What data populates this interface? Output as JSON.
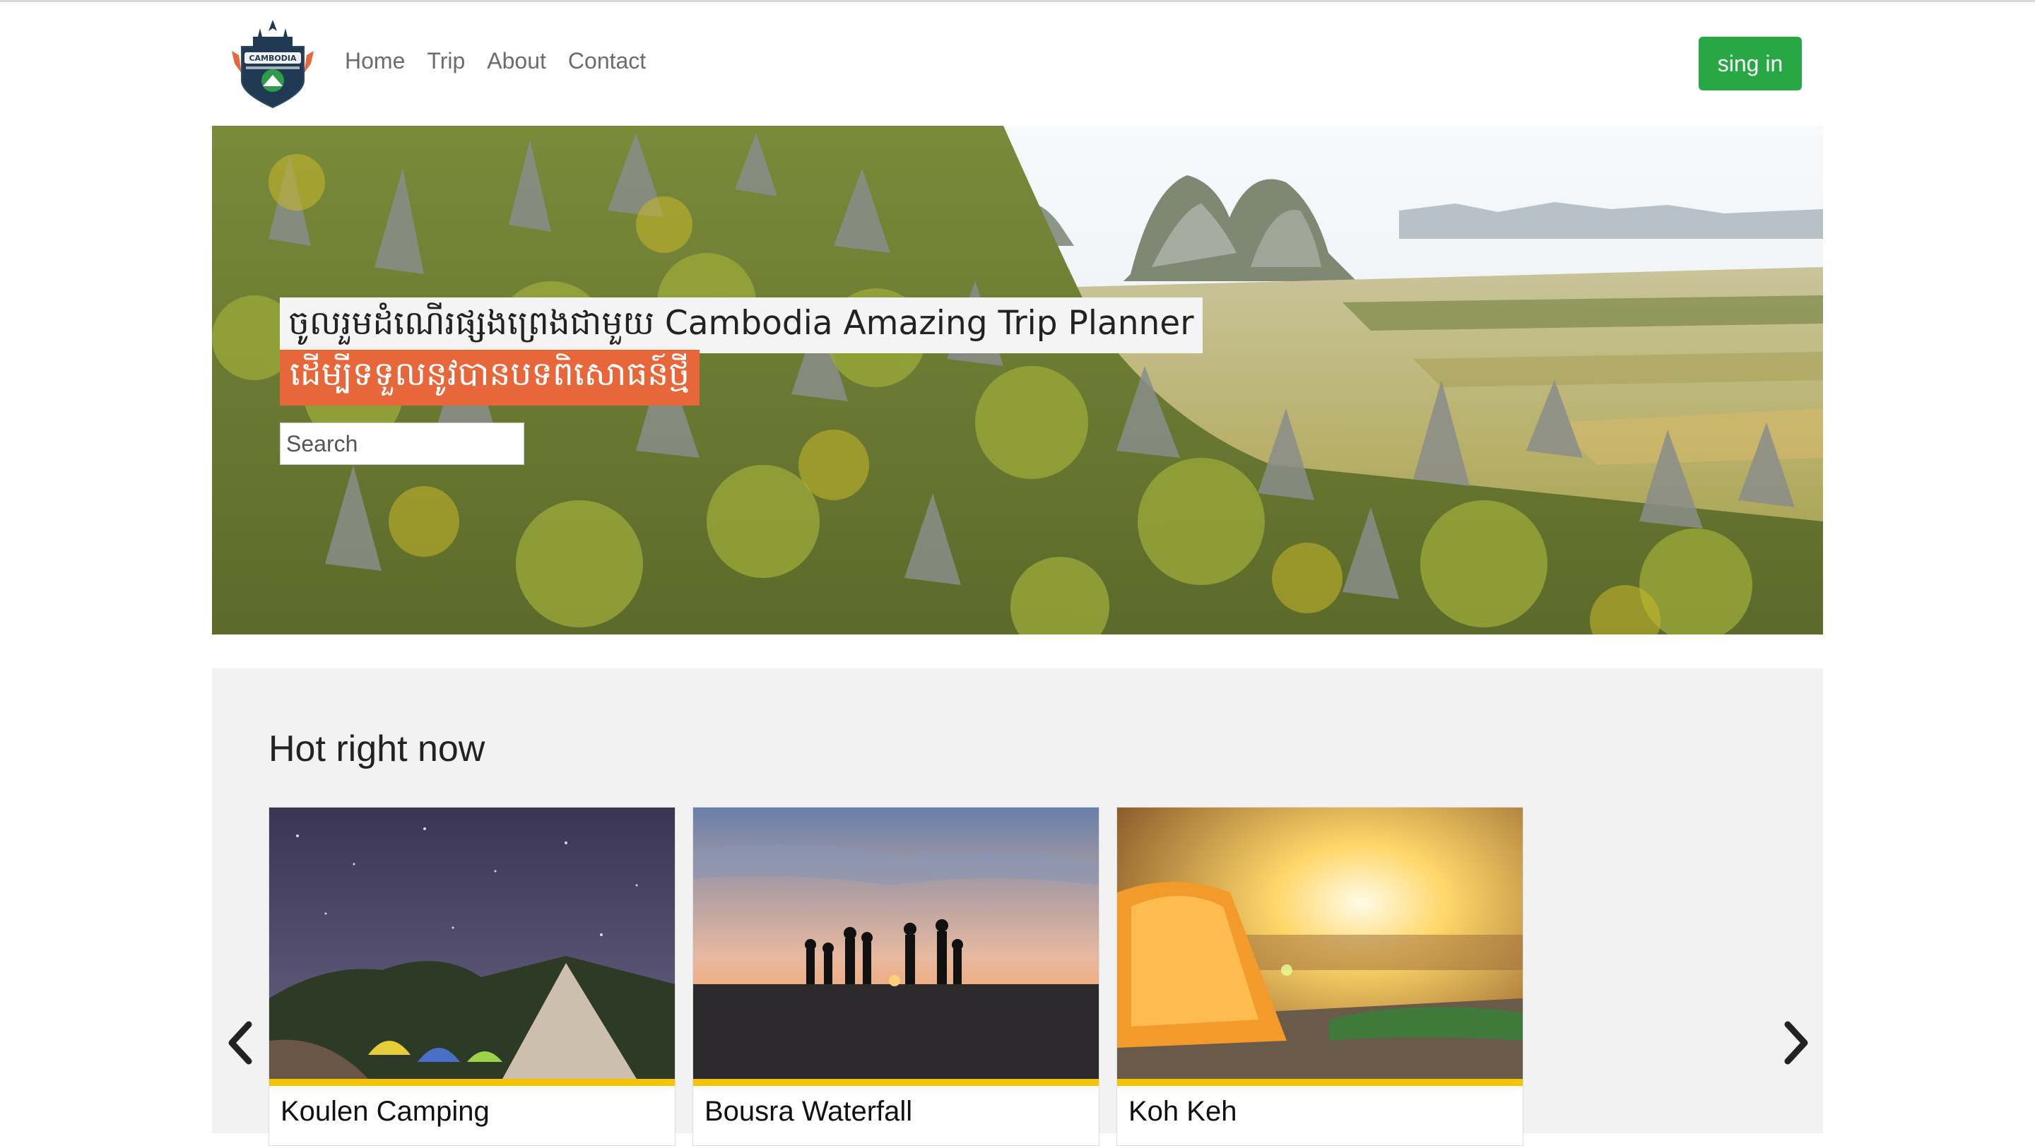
{
  "navbar": {
    "logo_alt": "Cambodia Amazing Trip Planner logo",
    "logo_text": "CAMBODIA",
    "links": [
      {
        "label": "Home"
      },
      {
        "label": "Trip"
      },
      {
        "label": "About"
      },
      {
        "label": "Contact"
      }
    ],
    "signin_label": "sing in"
  },
  "hero": {
    "title": "ចូលរួមដំណើរផ្សងព្រេងជាមួយ Cambodia Amazing Trip Planner",
    "subtitle": "ដើម្បីទទួលនូវបានបទពិសោធន៍ថ្មី",
    "search": {
      "placeholder": "Search",
      "value": ""
    }
  },
  "hot": {
    "heading": "Hot right now",
    "cards": [
      {
        "title": "Koulen Camping"
      },
      {
        "title": "Bousra Waterfall"
      },
      {
        "title": "Koh Keh"
      }
    ]
  },
  "colors": {
    "brand_green": "#28a745",
    "subtitle_orange": "#e8673a",
    "card_accent": "#f5c400",
    "section_bg": "#f2f2f2"
  },
  "icons": {
    "prev": "chevron-left-icon",
    "next": "chevron-right-icon"
  }
}
